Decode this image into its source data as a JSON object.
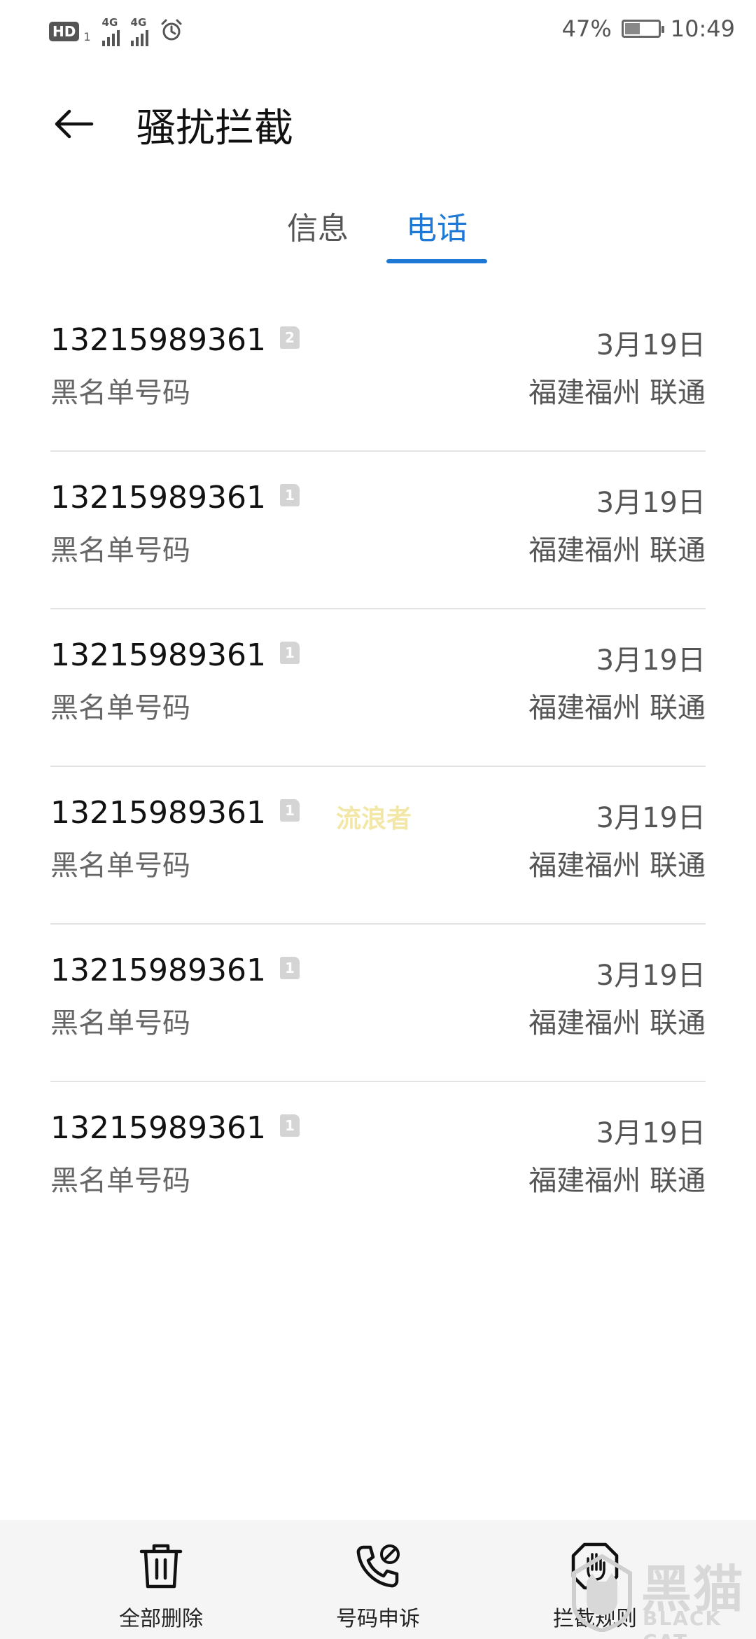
{
  "status_bar": {
    "hd": "HD",
    "sim1_label": "1",
    "sig1_label": "4G",
    "sig2_label": "4G",
    "battery_pct": "47%",
    "battery_level": 0.47,
    "time": "10:49"
  },
  "header": {
    "title": "骚扰拦截"
  },
  "tabs": [
    {
      "label": "信息",
      "active": false
    },
    {
      "label": "电话",
      "active": true
    }
  ],
  "calls": [
    {
      "number": "13215989361",
      "sim": "2",
      "tag": "黑名单号码",
      "date": "3月19日",
      "location": "福建福州 联通"
    },
    {
      "number": "13215989361",
      "sim": "1",
      "tag": "黑名单号码",
      "date": "3月19日",
      "location": "福建福州 联通"
    },
    {
      "number": "13215989361",
      "sim": "1",
      "tag": "黑名单号码",
      "date": "3月19日",
      "location": "福建福州 联通"
    },
    {
      "number": "13215989361",
      "sim": "1",
      "tag": "黑名单号码",
      "date": "3月19日",
      "location": "福建福州 联通"
    },
    {
      "number": "13215989361",
      "sim": "1",
      "tag": "黑名单号码",
      "date": "3月19日",
      "location": "福建福州 联通"
    },
    {
      "number": "13215989361",
      "sim": "1",
      "tag": "黑名单号码",
      "date": "3月19日",
      "location": "福建福州 联通"
    }
  ],
  "watermark": "流浪者",
  "bottom_actions": [
    {
      "label": "全部删除",
      "icon": "trash-icon"
    },
    {
      "label": "号码申诉",
      "icon": "phone-blocked-icon"
    },
    {
      "label": "拦截规则",
      "icon": "hand-stop-icon"
    }
  ],
  "brand_watermark": {
    "cn": "黑猫",
    "en": "BLACK CAT"
  },
  "colors": {
    "accent": "#1e78d6",
    "divider": "#e3e3e3",
    "bottom_bar": "#f5f5f5"
  }
}
